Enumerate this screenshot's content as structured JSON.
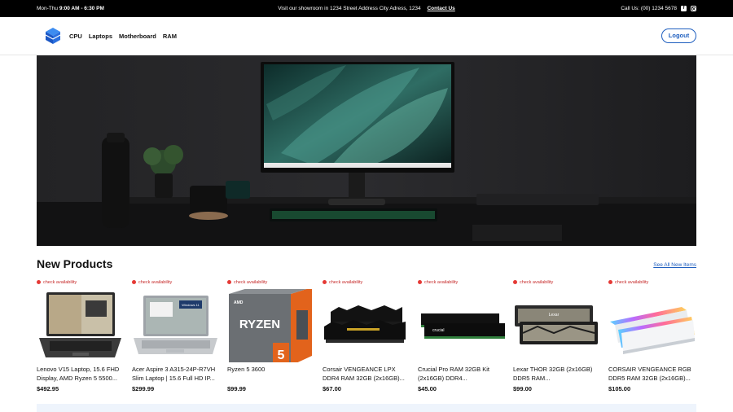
{
  "topbar": {
    "hours_label": "Mon-Thu",
    "hours_time": "9:00 AM - 6:30 PM",
    "showroom_text": "Visit our showroom in 1234 Street Address City Adress, 1234",
    "contact_link": "Contact Us",
    "call_text": "Call Us: (00) 1234 5678"
  },
  "nav": {
    "links": [
      "CPU",
      "Laptops",
      "Motherboard",
      "RAM"
    ],
    "logout": "Logout"
  },
  "section": {
    "title": "New Products",
    "see_all": "See All New Items"
  },
  "products": [
    {
      "availability": "check availability",
      "name": "Lenovo V15 Laptop, 15.6 FHD Display, AMD Ryzen 5 5500...",
      "price": "$492.95"
    },
    {
      "availability": "check availability",
      "name": "Acer Aspire 3 A315-24P-R7VH Slim Laptop | 15.6 Full HD IP...",
      "price": "$299.99"
    },
    {
      "availability": "check availability",
      "name": "Ryzen 5 3600",
      "price": "$99.99"
    },
    {
      "availability": "check availability",
      "name": "Corsair VENGEANCE LPX DDR4 RAM 32GB (2x16GB)...",
      "price": "$67.00"
    },
    {
      "availability": "check availability",
      "name": "Crucial Pro RAM 32GB Kit (2x16GB) DDR4...",
      "price": "$45.00"
    },
    {
      "availability": "check availability",
      "name": "Lexar THOR 32GB (2x16GB) DDR5 RAM...",
      "price": "$99.00"
    },
    {
      "availability": "check availability",
      "name": "CORSAIR VENGEANCE RGB DDR5 RAM 32GB (2x16GB)...",
      "price": "$105.00"
    }
  ],
  "product_image_text": {
    "ryzen_brand": "RYZEN",
    "ryzen_tier": "5",
    "amd": "AMD",
    "lexar": "Lexar",
    "crucial": "crucial",
    "windows": "Windows 11"
  },
  "colors": {
    "accent": "#1f5fbf",
    "availability": "#e53935",
    "topbar_bg": "#000000"
  }
}
